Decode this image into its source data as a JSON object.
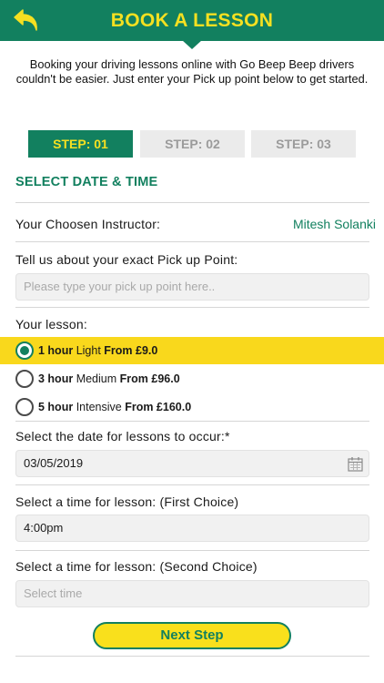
{
  "header": {
    "title": "BOOK A LESSON",
    "back_icon": "back-arrow-icon",
    "background_color": "#12805f",
    "title_color": "#f5e021"
  },
  "intro_text": "Booking your driving lessons online with Go Beep Beep drivers couldn't be easier. Just enter your Pick up point below to get started.",
  "steps": [
    {
      "label": "STEP: 01",
      "active": true
    },
    {
      "label": "STEP: 02",
      "active": false
    },
    {
      "label": "STEP: 03",
      "active": false
    }
  ],
  "section_title": "SELECT DATE & TIME",
  "instructor": {
    "label": "Your Choosen Instructor:",
    "name": "Mitesh Solanki"
  },
  "pickup": {
    "label": "Tell us about your exact Pick up Point:",
    "placeholder": "Please type your pick up point here.."
  },
  "lesson": {
    "label": "Your lesson:",
    "options": [
      {
        "duration": "1 hour",
        "level": "Light",
        "price": "From £9.0",
        "selected": true
      },
      {
        "duration": "3 hour",
        "level": "Medium",
        "price": "From £96.0",
        "selected": false
      },
      {
        "duration": "5 hour",
        "level": "Intensive",
        "price": "From £160.0",
        "selected": false
      }
    ]
  },
  "date": {
    "label": "Select the date for lessons to occur:*",
    "value": "03/05/2019",
    "icon": "calendar-icon"
  },
  "time_first": {
    "label": "Select a time for lesson: (First Choice)",
    "value": "4:00pm"
  },
  "time_second": {
    "label": "Select a time for lesson: (Second Choice)",
    "placeholder": "Select time"
  },
  "next_button": "Next Step",
  "colors": {
    "brand_green": "#12805f",
    "brand_yellow": "#f9d81c"
  }
}
